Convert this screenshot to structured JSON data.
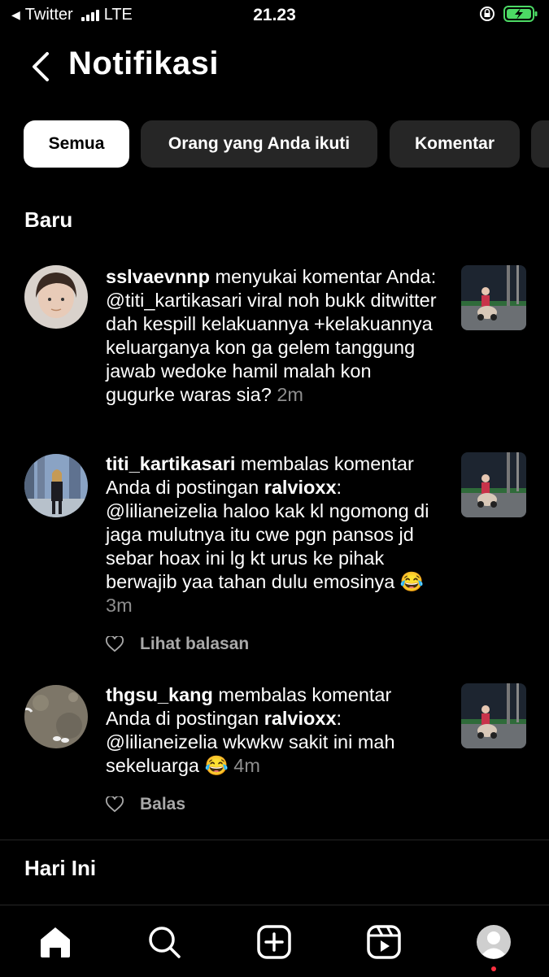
{
  "status_bar": {
    "carrier": "Twitter",
    "network": "LTE",
    "time": "21.23"
  },
  "header": {
    "title": "Notifikasi"
  },
  "filters": [
    {
      "label": "Semua",
      "active": true
    },
    {
      "label": "Orang yang Anda ikuti",
      "active": false
    },
    {
      "label": "Komentar",
      "active": false
    }
  ],
  "sections": {
    "new": "Baru",
    "today": "Hari Ini"
  },
  "notifications": [
    {
      "user": "sslvaevnnp",
      "text": " menyukai komentar Anda: @titi_kartikasari viral noh bukk ditwitter dah kespill kelakuannya +kelakuannya keluarganya kon ga gelem tanggung jawab wedoke hamil malah kon gugurke waras sia?",
      "emoji": "",
      "time": "2m"
    },
    {
      "user": "titi_kartikasari",
      "text_a": " membalas komentar Anda di postingan ",
      "mention": "ralvioxx",
      "text_b": ": @lilianeizelia haloo kak kl ngomong di jaga mulutnya itu cwe pgn pansos jd sebar hoax ini lg kt urus ke pihak berwajib yaa  tahan dulu emosinya ",
      "emoji": "😂",
      "time": "3m",
      "action": "Lihat balasan"
    },
    {
      "user": "thgsu_kang",
      "text_a": " membalas komentar Anda di postingan ",
      "mention": "ralvioxx",
      "text_b": ": @lilianeizelia wkwkw sakit ini mah sekeluarga ",
      "emoji": "😂",
      "time": "4m",
      "action": "Balas"
    }
  ],
  "icons": [
    "chevron-left-icon",
    "home-icon",
    "search-icon",
    "plus-square-icon",
    "reels-icon",
    "profile-avatar",
    "heart-icon"
  ],
  "colors": {
    "background": "#000000",
    "chip": "#262626",
    "muted": "#8e8e8e",
    "notification_dot": "#ff3040",
    "battery": "#4cd964"
  }
}
